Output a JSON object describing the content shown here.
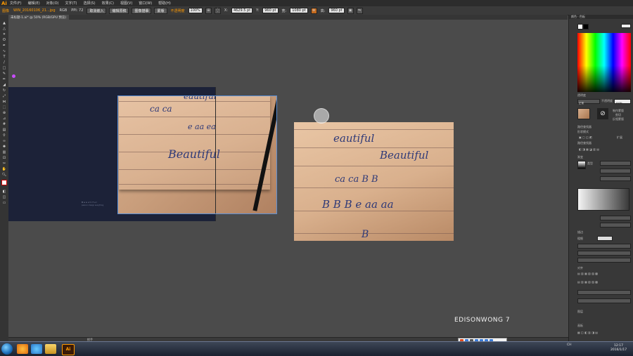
{
  "app": {
    "logo": "Ai"
  },
  "menu": [
    "文件(F)",
    "编辑(E)",
    "对象(O)",
    "文字(T)",
    "选择(S)",
    "效果(C)",
    "视图(V)",
    "窗口(W)",
    "帮助(H)"
  ],
  "control": {
    "group_label": "图像",
    "file_name": "WIN_20160106_21...jpg",
    "color_mode": "RGB",
    "ppi": "PPI: 72",
    "embed_button": "取消嵌入",
    "edit_button": "编辑原稿",
    "trace_button": "图像描摹",
    "mask_button": "蒙版",
    "opacity_label": "不透明度",
    "opacity_value": "100%",
    "x_value": "4629.5 pt",
    "y_value": "960 pt",
    "w_value": "1080 pt",
    "h_value": "960 pt"
  },
  "doc_tab": "未标题-1.ai* @ 50% (RGB/GPU 预览)",
  "artboard": {
    "brand": "Beautiful",
    "sub": "peace in design everything"
  },
  "photo1": {
    "lines": [
      "eautiful",
      "ca  ca",
      "e  aa  ea",
      "Beautiful"
    ]
  },
  "photo2": {
    "lines": [
      "eautiful",
      "Beautiful",
      "ca  ca  B  B",
      "B  B  B  e  aa  aa",
      "B"
    ]
  },
  "watermark": "EDISONWONG 7",
  "panel": {
    "color_tab": "颜色",
    "swatch_tab": "色板",
    "transparency": "透明度",
    "blend_mode": "正常",
    "opacity_label": "不透明度",
    "opacity_value": "100%",
    "mask_btn": "制作蒙版",
    "clip_label": "剪切",
    "invert_label": "反相蒙版",
    "pathfinder": "路径查找器",
    "shape_mode": "形状模式",
    "expand_label": "扩展",
    "path_label": "路径查找器",
    "gradient": "渐变",
    "gradient_type": "类型",
    "stroke": "描边",
    "weight": "粗细",
    "align_label": "对齐",
    "layers_label": "图层",
    "artboards_label": "画板"
  },
  "statusbar": {
    "tool": "抓手"
  },
  "taskbar": {
    "tray_lang": "CH",
    "time": "12:17",
    "date": "2016/1/17"
  }
}
